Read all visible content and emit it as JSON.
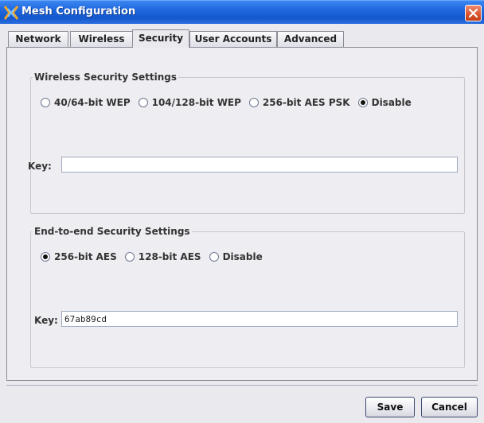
{
  "window": {
    "title": "Mesh Configuration",
    "icon": "mesh-network-icon"
  },
  "tabs": [
    {
      "label": "Network",
      "active": false
    },
    {
      "label": "Wireless",
      "active": false
    },
    {
      "label": "Security",
      "active": true
    },
    {
      "label": "User Accounts",
      "active": false
    },
    {
      "label": "Advanced",
      "active": false
    }
  ],
  "wireless_security": {
    "title": "Wireless Security Settings",
    "options": [
      "40/64-bit WEP",
      "104/128-bit WEP",
      "256-bit AES PSK",
      "Disable"
    ],
    "selected": "Disable",
    "key_label": "Key:",
    "key_value": ""
  },
  "end_to_end_security": {
    "title": "End-to-end Security Settings",
    "options": [
      "256-bit AES",
      "128-bit AES",
      "Disable"
    ],
    "selected": "256-bit AES",
    "key_label": "Key:",
    "key_value": "67ab89cd"
  },
  "buttons": {
    "save": "Save",
    "cancel": "Cancel"
  },
  "colors": {
    "titlebar": "#1f66dc",
    "close_button": "#d9532c",
    "window_bg": "#e9e9ee"
  }
}
